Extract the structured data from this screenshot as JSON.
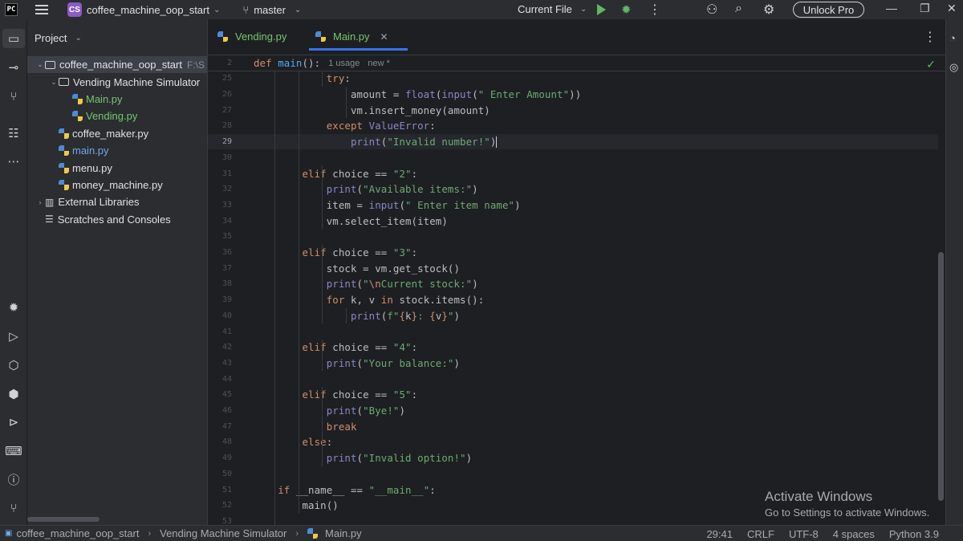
{
  "titlebar": {
    "project_badge": "CS",
    "project_name": "coffee_machine_oop_start",
    "branch": "master",
    "run_config": "Current File",
    "unlock_label": "Unlock Pro"
  },
  "project_panel": {
    "header": "Project",
    "tree": [
      {
        "label": "coffee_machine_oop_start",
        "hint": "F:\\S",
        "type": "folder",
        "depth": 0,
        "expanded": true,
        "selected": true
      },
      {
        "label": "Vending Machine Simulator",
        "type": "folder",
        "depth": 1,
        "expanded": true
      },
      {
        "label": "Main.py",
        "type": "py",
        "depth": 2,
        "color": "green"
      },
      {
        "label": "Vending.py",
        "type": "py",
        "depth": 2,
        "color": "green"
      },
      {
        "label": "coffee_maker.py",
        "type": "py",
        "depth": 1
      },
      {
        "label": "main.py",
        "type": "py",
        "depth": 1,
        "color": "blue"
      },
      {
        "label": "menu.py",
        "type": "py",
        "depth": 1
      },
      {
        "label": "money_machine.py",
        "type": "py",
        "depth": 1
      },
      {
        "label": "External Libraries",
        "type": "lib",
        "depth": 0,
        "collapsed": true
      },
      {
        "label": "Scratches and Consoles",
        "type": "scratch",
        "depth": 0
      }
    ]
  },
  "tabs": [
    {
      "label": "Vending.py",
      "active": false
    },
    {
      "label": "Main.py",
      "active": true
    }
  ],
  "sticky": {
    "line_number": "2",
    "hint_usage": "1 usage",
    "hint_new": "new *"
  },
  "code": {
    "current_line": "29",
    "lines": [
      {
        "n": "25",
        "t": "            try:"
      },
      {
        "n": "26",
        "t": "                amount = float(input(\" Enter Amount\"))"
      },
      {
        "n": "27",
        "t": "                vm.insert_money(amount)"
      },
      {
        "n": "28",
        "t": "            except ValueError:"
      },
      {
        "n": "29",
        "t": "                print(\"Invalid number!\")"
      },
      {
        "n": "30",
        "t": ""
      },
      {
        "n": "31",
        "t": "        elif choice == \"2\":"
      },
      {
        "n": "32",
        "t": "            print(\"Available items:\")"
      },
      {
        "n": "33",
        "t": "            item = input(\" Enter item name\")"
      },
      {
        "n": "34",
        "t": "            vm.select_item(item)"
      },
      {
        "n": "35",
        "t": ""
      },
      {
        "n": "36",
        "t": "        elif choice == \"3\":"
      },
      {
        "n": "37",
        "t": "            stock = vm.get_stock()"
      },
      {
        "n": "38",
        "t": "            print(\"\\nCurrent stock:\")"
      },
      {
        "n": "39",
        "t": "            for k, v in stock.items():"
      },
      {
        "n": "40",
        "t": "                print(f\"{k}: {v}\")"
      },
      {
        "n": "41",
        "t": ""
      },
      {
        "n": "42",
        "t": "        elif choice == \"4\":"
      },
      {
        "n": "43",
        "t": "            print(\"Your balance:\")"
      },
      {
        "n": "44",
        "t": ""
      },
      {
        "n": "45",
        "t": "        elif choice == \"5\":"
      },
      {
        "n": "46",
        "t": "            print(\"Bye!\")"
      },
      {
        "n": "47",
        "t": "            break"
      },
      {
        "n": "48",
        "t": "        else:"
      },
      {
        "n": "49",
        "t": "            print(\"Invalid option!\")"
      },
      {
        "n": "50",
        "t": ""
      },
      {
        "n": "51",
        "t": "    if __name__ == \"__main__\":"
      },
      {
        "n": "52",
        "t": "        main()"
      },
      {
        "n": "53",
        "t": ""
      }
    ]
  },
  "watermark": {
    "title": "Activate Windows",
    "subtitle": "Go to Settings to activate Windows."
  },
  "statusbar": {
    "breadcrumb": [
      "coffee_machine_oop_start",
      "Vending Machine Simulator",
      "Main.py"
    ],
    "position": "29:41",
    "line_sep": "CRLF",
    "encoding": "UTF-8",
    "indent": "4 spaces",
    "interpreter": "Python 3.9"
  },
  "colors": {
    "background": "#1e1f22",
    "panel": "#2b2d30",
    "accent": "#3574f0",
    "keyword": "#cf8e6d",
    "string": "#6aab73",
    "function": "#56a8f5"
  }
}
